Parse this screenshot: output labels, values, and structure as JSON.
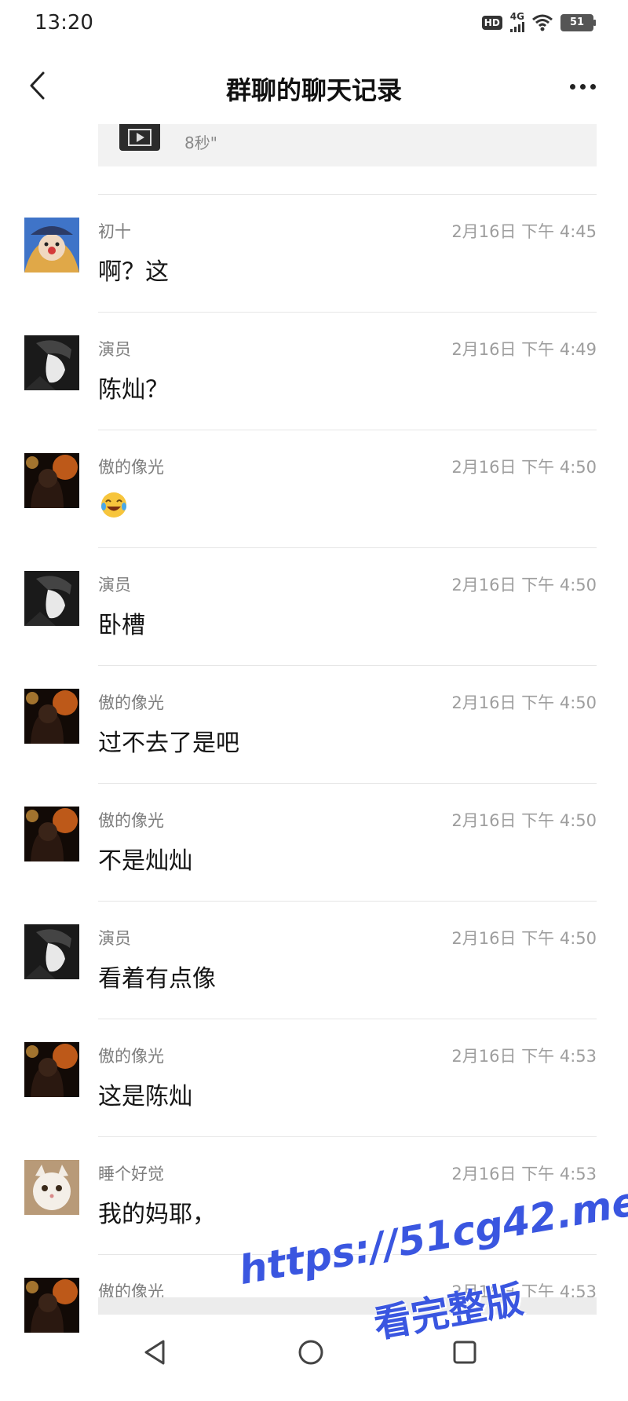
{
  "status_bar": {
    "time": "13:20",
    "hd_label": "HD",
    "network_label": "4G",
    "battery_level": "51"
  },
  "header": {
    "title": "群聊的聊天记录"
  },
  "top_card": {
    "video_duration": "8秒\""
  },
  "messages": [
    {
      "sender": "初十",
      "time": "2月16日 下午 4:45",
      "text": "啊？这",
      "avatar": "clown"
    },
    {
      "sender": "演员",
      "time": "2月16日 下午 4:49",
      "text": "陈灿？",
      "avatar": "bw-portrait"
    },
    {
      "sender": "傲的像光",
      "time": "2月16日 下午 4:50",
      "text": "",
      "emoji": "tears-of-joy",
      "avatar": "dark-warm"
    },
    {
      "sender": "演员",
      "time": "2月16日 下午 4:50",
      "text": "卧槽",
      "avatar": "bw-portrait"
    },
    {
      "sender": "傲的像光",
      "time": "2月16日 下午 4:50",
      "text": "过不去了是吧",
      "avatar": "dark-warm"
    },
    {
      "sender": "傲的像光",
      "time": "2月16日 下午 4:50",
      "text": "不是灿灿",
      "avatar": "dark-warm"
    },
    {
      "sender": "演员",
      "time": "2月16日 下午 4:50",
      "text": "看着有点像",
      "avatar": "bw-portrait"
    },
    {
      "sender": "傲的像光",
      "time": "2月16日 下午 4:53",
      "text": "这是陈灿",
      "avatar": "dark-warm"
    },
    {
      "sender": "睡个好觉",
      "time": "2月16日 下午 4:53",
      "text": "我的妈耶，",
      "avatar": "kitten"
    },
    {
      "sender": "傲的像光",
      "time": "2月16日 下午 4:53",
      "text": "",
      "avatar": "dark-warm"
    }
  ],
  "watermark": {
    "url": "https://51cg42.me",
    "subtitle": "看完整版"
  },
  "colors": {
    "watermark": "#3a56e0",
    "divider": "#e6e6e6",
    "meta_text": "#9e9e9e"
  }
}
